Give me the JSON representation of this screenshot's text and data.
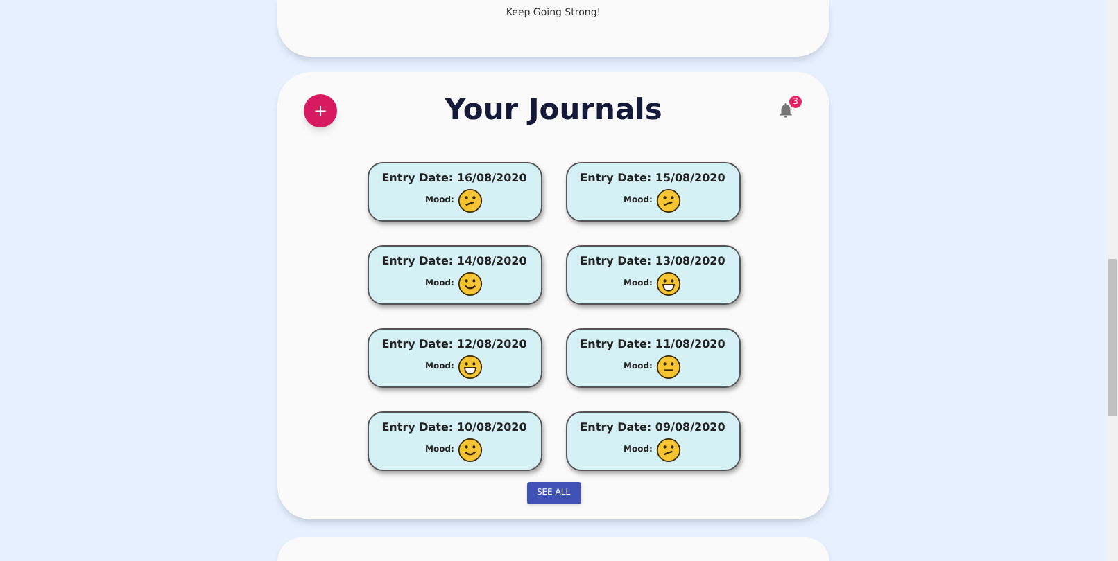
{
  "top_card": {
    "message": "Keep Going Strong!"
  },
  "journals": {
    "add_button": "+",
    "title": "Your Journals",
    "notification_count": "3",
    "entries": [
      {
        "date_label": "Entry Date: 16/08/2020",
        "mood_label": "Mood:",
        "kind": "confused"
      },
      {
        "date_label": "Entry Date: 15/08/2020",
        "mood_label": "Mood:",
        "kind": "confused"
      },
      {
        "date_label": "Entry Date: 14/08/2020",
        "mood_label": "Mood:",
        "kind": "smile"
      },
      {
        "date_label": "Entry Date: 13/08/2020",
        "mood_label": "Mood:",
        "kind": "grin"
      },
      {
        "date_label": "Entry Date: 12/08/2020",
        "mood_label": "Mood:",
        "kind": "grin"
      },
      {
        "date_label": "Entry Date: 11/08/2020",
        "mood_label": "Mood:",
        "kind": "neutral"
      },
      {
        "date_label": "Entry Date: 10/08/2020",
        "mood_label": "Mood:",
        "kind": "smile"
      },
      {
        "date_label": "Entry Date: 09/08/2020",
        "mood_label": "Mood:",
        "kind": "confused"
      }
    ],
    "see_all_button": "SEE ALL"
  }
}
